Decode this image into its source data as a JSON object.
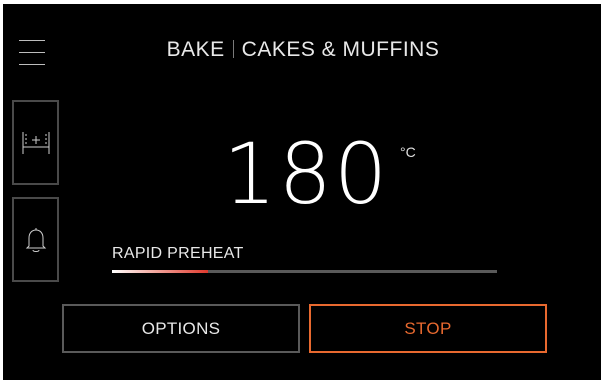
{
  "header": {
    "mode": "BAKE",
    "program": "CAKES & MUFFINS"
  },
  "temperature": {
    "value": "180",
    "unit": "°C"
  },
  "status": {
    "label": "RAPID PREHEAT",
    "progress": 0.25
  },
  "buttons": {
    "options": "OPTIONS",
    "stop": "STOP"
  },
  "icons": {
    "menu": "hamburger-menu-icon",
    "shelf": "oven-shelf-icon",
    "timer": "bell-icon"
  },
  "colors": {
    "background": "#000000",
    "accent": "#e8692f",
    "progress_end": "#e03a2e"
  }
}
